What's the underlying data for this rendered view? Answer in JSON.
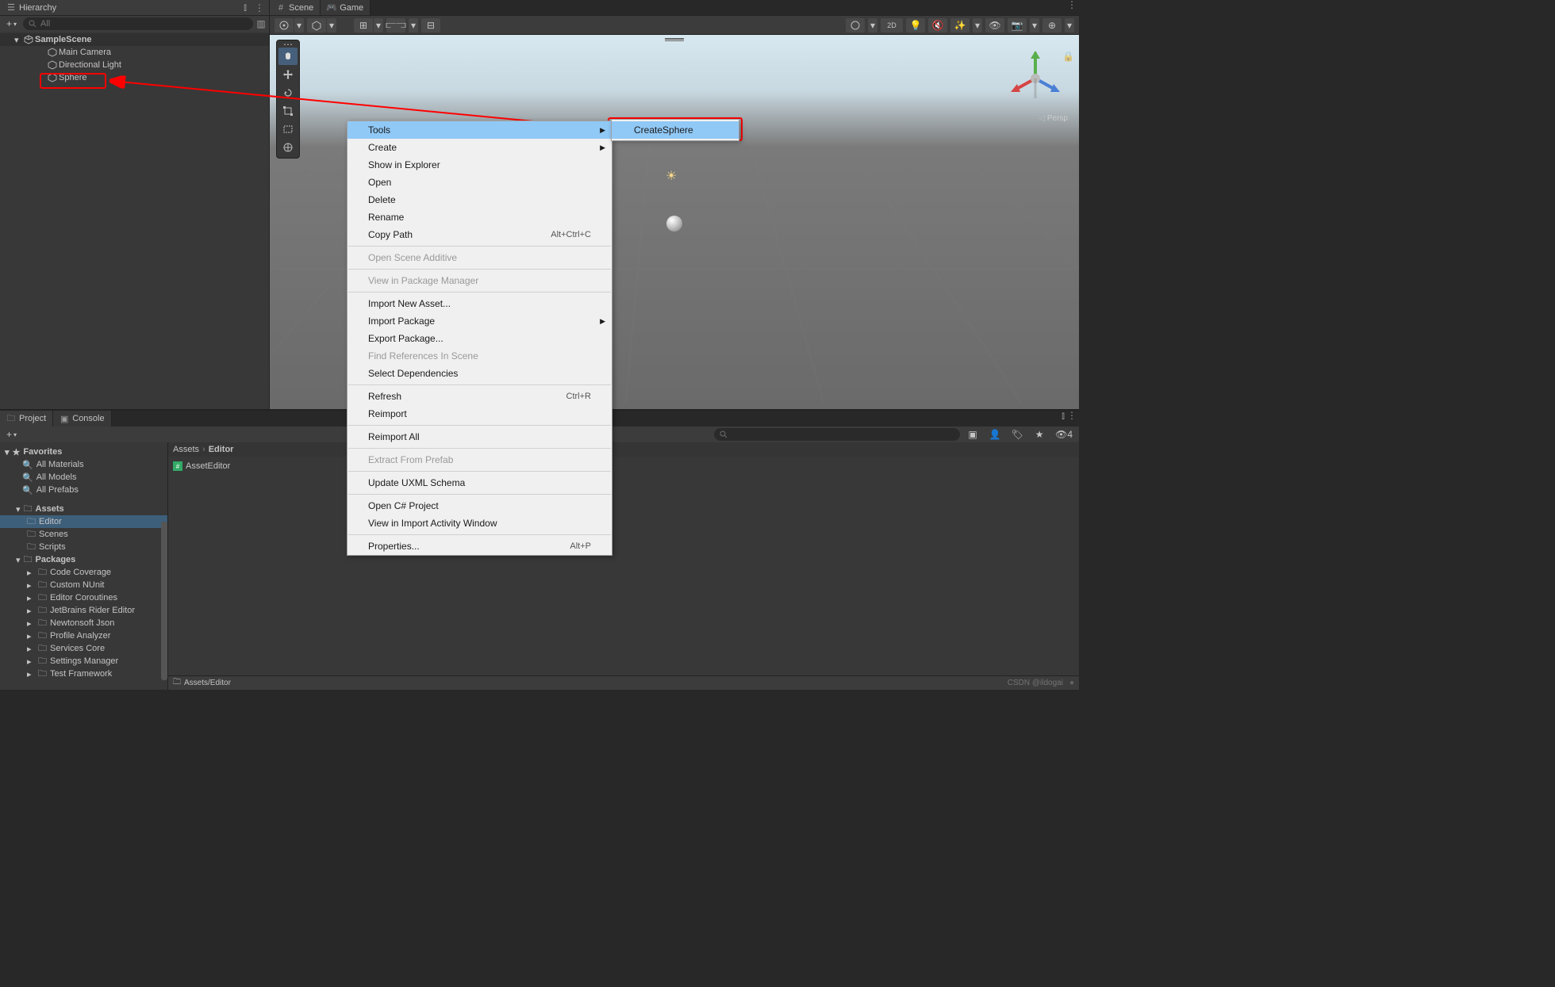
{
  "hierarchy": {
    "tab": "Hierarchy",
    "search_placeholder": "All",
    "scene": "SampleScene",
    "items": [
      "Main Camera",
      "Directional Light",
      "Sphere"
    ]
  },
  "scene": {
    "tab_scene": "Scene",
    "tab_game": "Game",
    "persp": "Persp",
    "toolbar_2d": "2D"
  },
  "context_menu": {
    "items": [
      {
        "label": "Tools",
        "sub": true,
        "highlighted": true
      },
      {
        "label": "Create",
        "sub": true
      },
      {
        "label": "Show in Explorer"
      },
      {
        "label": "Open"
      },
      {
        "label": "Delete"
      },
      {
        "label": "Rename"
      },
      {
        "label": "Copy Path",
        "shortcut": "Alt+Ctrl+C"
      },
      {
        "sep": true
      },
      {
        "label": "Open Scene Additive",
        "disabled": true
      },
      {
        "sep": true
      },
      {
        "label": "View in Package Manager",
        "disabled": true
      },
      {
        "sep": true
      },
      {
        "label": "Import New Asset..."
      },
      {
        "label": "Import Package",
        "sub": true
      },
      {
        "label": "Export Package..."
      },
      {
        "label": "Find References In Scene",
        "disabled": true
      },
      {
        "label": "Select Dependencies"
      },
      {
        "sep": true
      },
      {
        "label": "Refresh",
        "shortcut": "Ctrl+R"
      },
      {
        "label": "Reimport"
      },
      {
        "sep": true
      },
      {
        "label": "Reimport All"
      },
      {
        "sep": true
      },
      {
        "label": "Extract From Prefab",
        "disabled": true
      },
      {
        "sep": true
      },
      {
        "label": "Update UXML Schema"
      },
      {
        "sep": true
      },
      {
        "label": "Open C# Project"
      },
      {
        "label": "View in Import Activity Window"
      },
      {
        "sep": true
      },
      {
        "label": "Properties...",
        "shortcut": "Alt+P"
      }
    ],
    "submenu_item": "CreateSphere"
  },
  "project": {
    "tab_project": "Project",
    "tab_console": "Console",
    "favorites": "Favorites",
    "fav_items": [
      "All Materials",
      "All Models",
      "All Prefabs"
    ],
    "assets": "Assets",
    "asset_folders": [
      "Editor",
      "Scenes",
      "Scripts"
    ],
    "packages": "Packages",
    "pkg_items": [
      "Code Coverage",
      "Custom NUnit",
      "Editor Coroutines",
      "JetBrains Rider Editor",
      "Newtonsoft Json",
      "Profile Analyzer",
      "Services Core",
      "Settings Manager",
      "Test Framework"
    ],
    "breadcrumb": [
      "Assets",
      "Editor"
    ],
    "assets_list": [
      "AssetEditor"
    ],
    "footer_path": "Assets/Editor",
    "hidden_count": "4"
  },
  "watermark": "CSDN @ildogai"
}
